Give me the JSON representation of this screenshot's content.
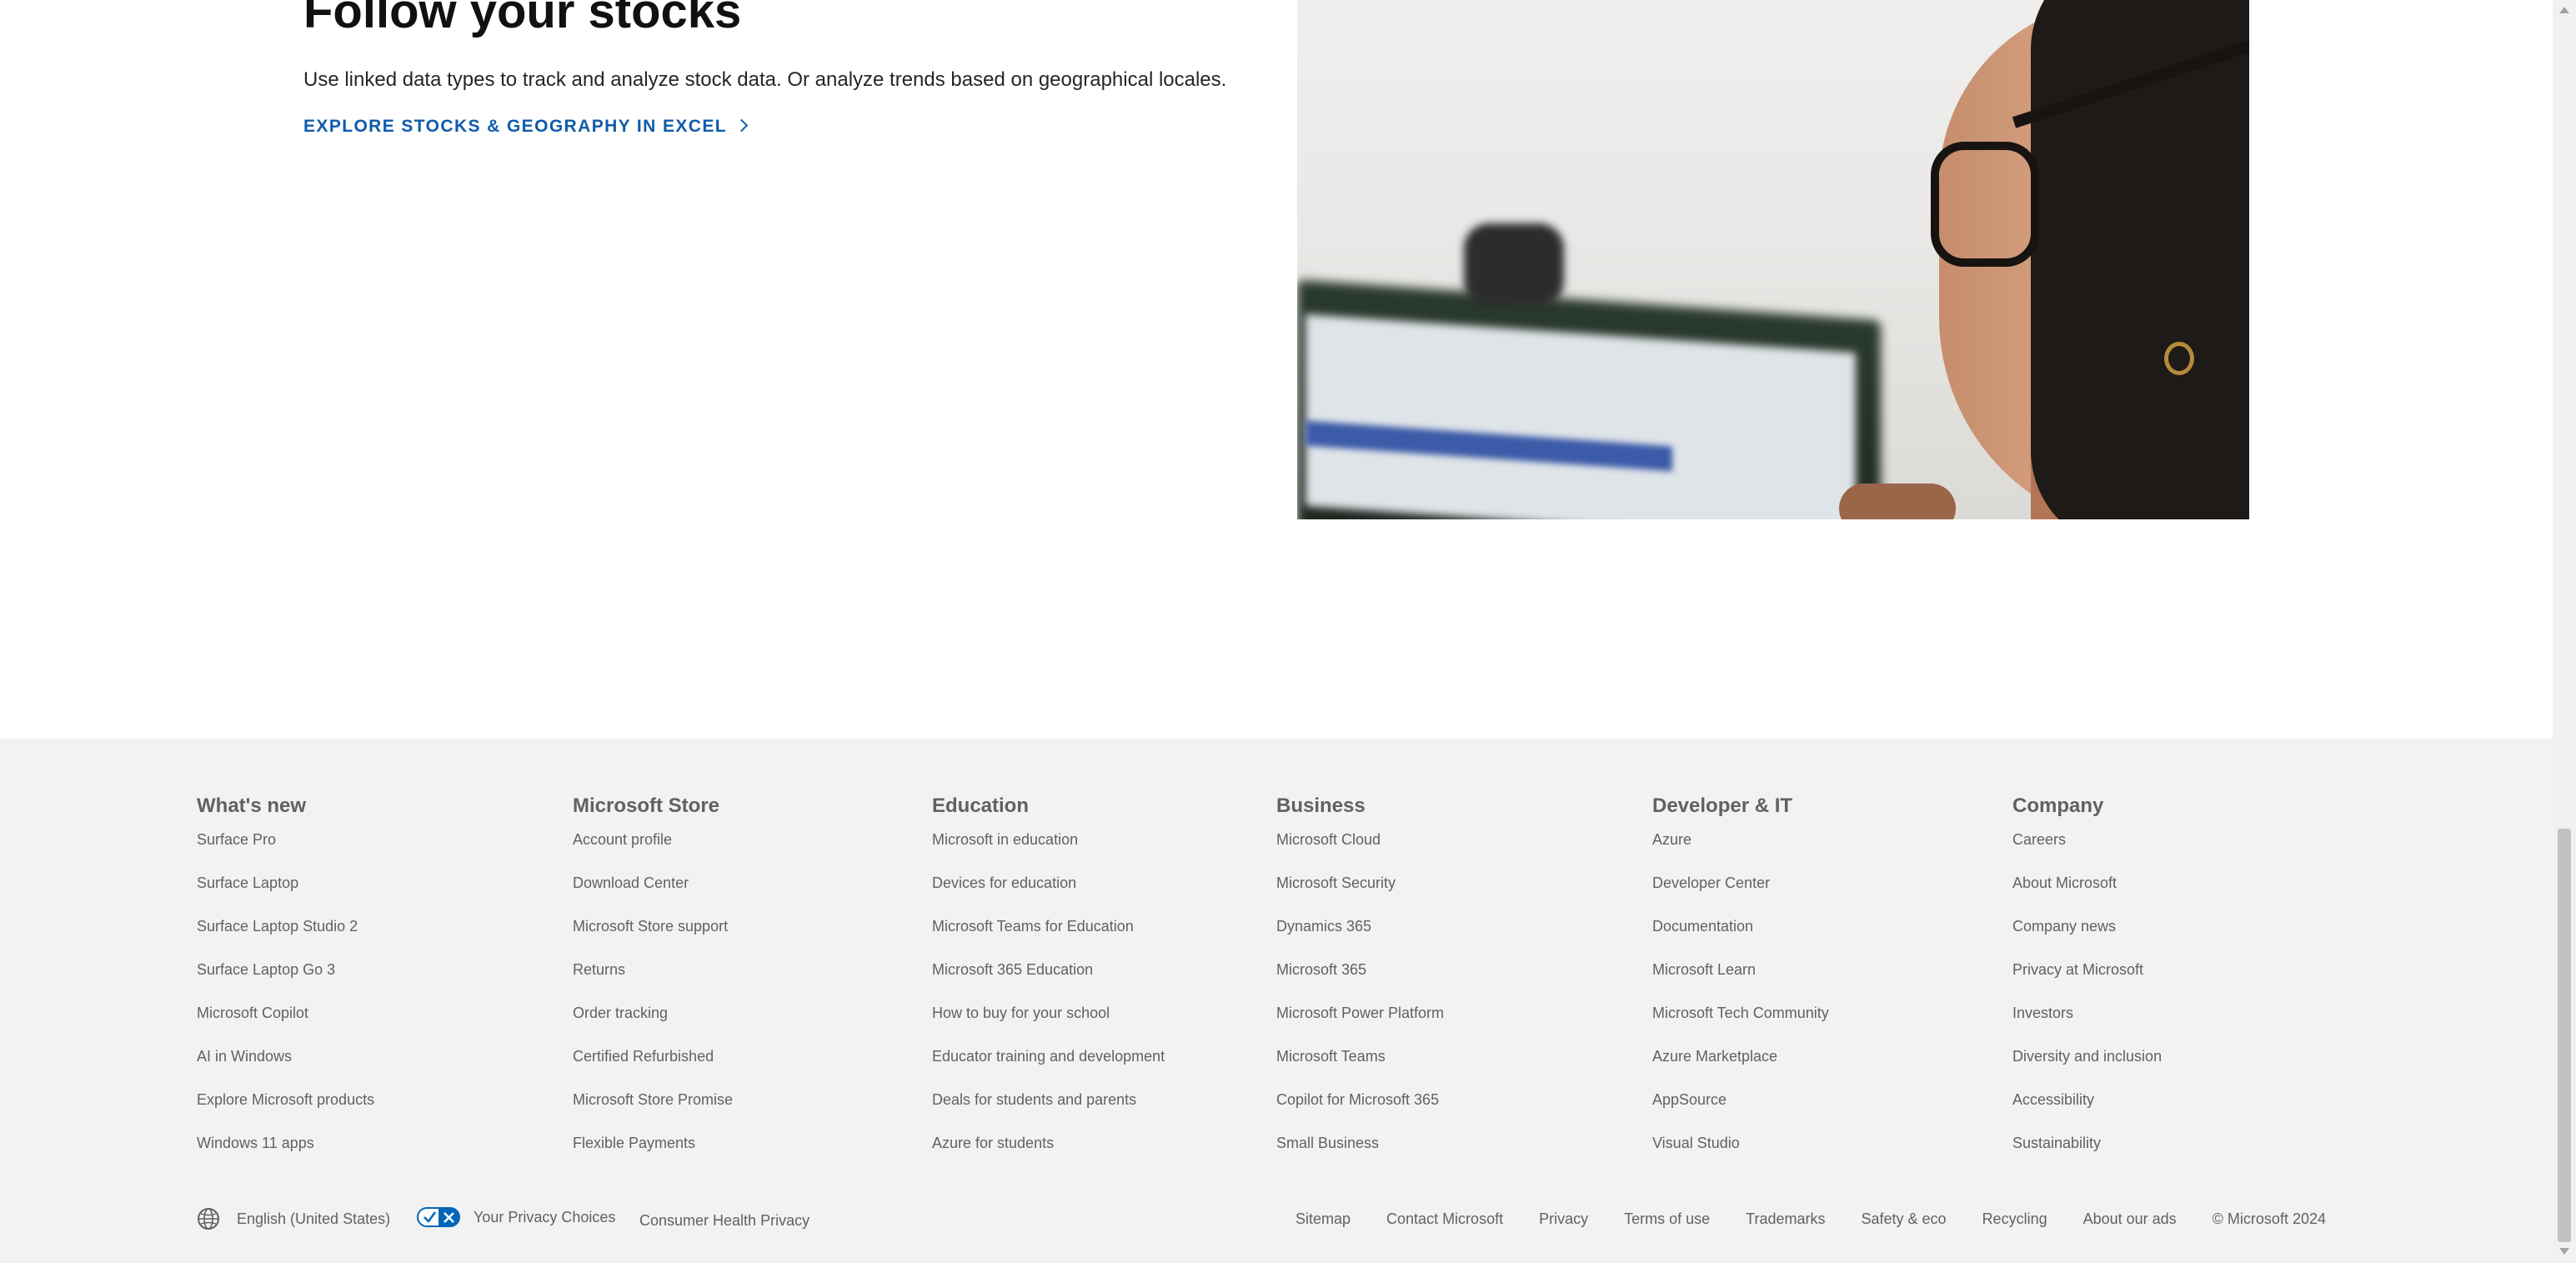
{
  "hero": {
    "title": "Follow your stocks",
    "description": "Use linked data types to track and analyze stock data. Or analyze trends based on geographical locales.",
    "link": "EXPLORE STOCKS & GEOGRAPHY IN EXCEL"
  },
  "footer": {
    "columns": [
      {
        "heading": "What's new",
        "items": [
          "Surface Pro",
          "Surface Laptop",
          "Surface Laptop Studio 2",
          "Surface Laptop Go 3",
          "Microsoft Copilot",
          "AI in Windows",
          "Explore Microsoft products",
          "Windows 11 apps"
        ]
      },
      {
        "heading": "Microsoft Store",
        "items": [
          "Account profile",
          "Download Center",
          "Microsoft Store support",
          "Returns",
          "Order tracking",
          "Certified Refurbished",
          "Microsoft Store Promise",
          "Flexible Payments"
        ]
      },
      {
        "heading": "Education",
        "items": [
          "Microsoft in education",
          "Devices for education",
          "Microsoft Teams for Education",
          "Microsoft 365 Education",
          "How to buy for your school",
          "Educator training and development",
          "Deals for students and parents",
          "Azure for students"
        ]
      },
      {
        "heading": "Business",
        "items": [
          "Microsoft Cloud",
          "Microsoft Security",
          "Dynamics 365",
          "Microsoft 365",
          "Microsoft Power Platform",
          "Microsoft Teams",
          "Copilot for Microsoft 365",
          "Small Business"
        ]
      },
      {
        "heading": "Developer & IT",
        "items": [
          "Azure",
          "Developer Center",
          "Documentation",
          "Microsoft Learn",
          "Microsoft Tech Community",
          "Azure Marketplace",
          "AppSource",
          "Visual Studio"
        ]
      },
      {
        "heading": "Company",
        "items": [
          "Careers",
          "About Microsoft",
          "Company news",
          "Privacy at Microsoft",
          "Investors",
          "Diversity and inclusion",
          "Accessibility",
          "Sustainability"
        ]
      }
    ],
    "bottom": {
      "language": "English (United States)",
      "privacy_choices": "Your Privacy Choices",
      "consumer_health": "Consumer Health Privacy",
      "links": [
        "Sitemap",
        "Contact Microsoft",
        "Privacy",
        "Terms of use",
        "Trademarks",
        "Safety & eco",
        "Recycling",
        "About our ads"
      ],
      "copyright": "© Microsoft 2024"
    }
  },
  "icons": {
    "globe": "globe-icon",
    "privacy_toggle": "privacy-toggle-icon",
    "link_chevron": "chevron-right-icon"
  },
  "colors": {
    "link": "#0f5bab",
    "footer_bg": "#f2f2f2",
    "footer_text": "#616161",
    "toggle": "#0067b8"
  }
}
